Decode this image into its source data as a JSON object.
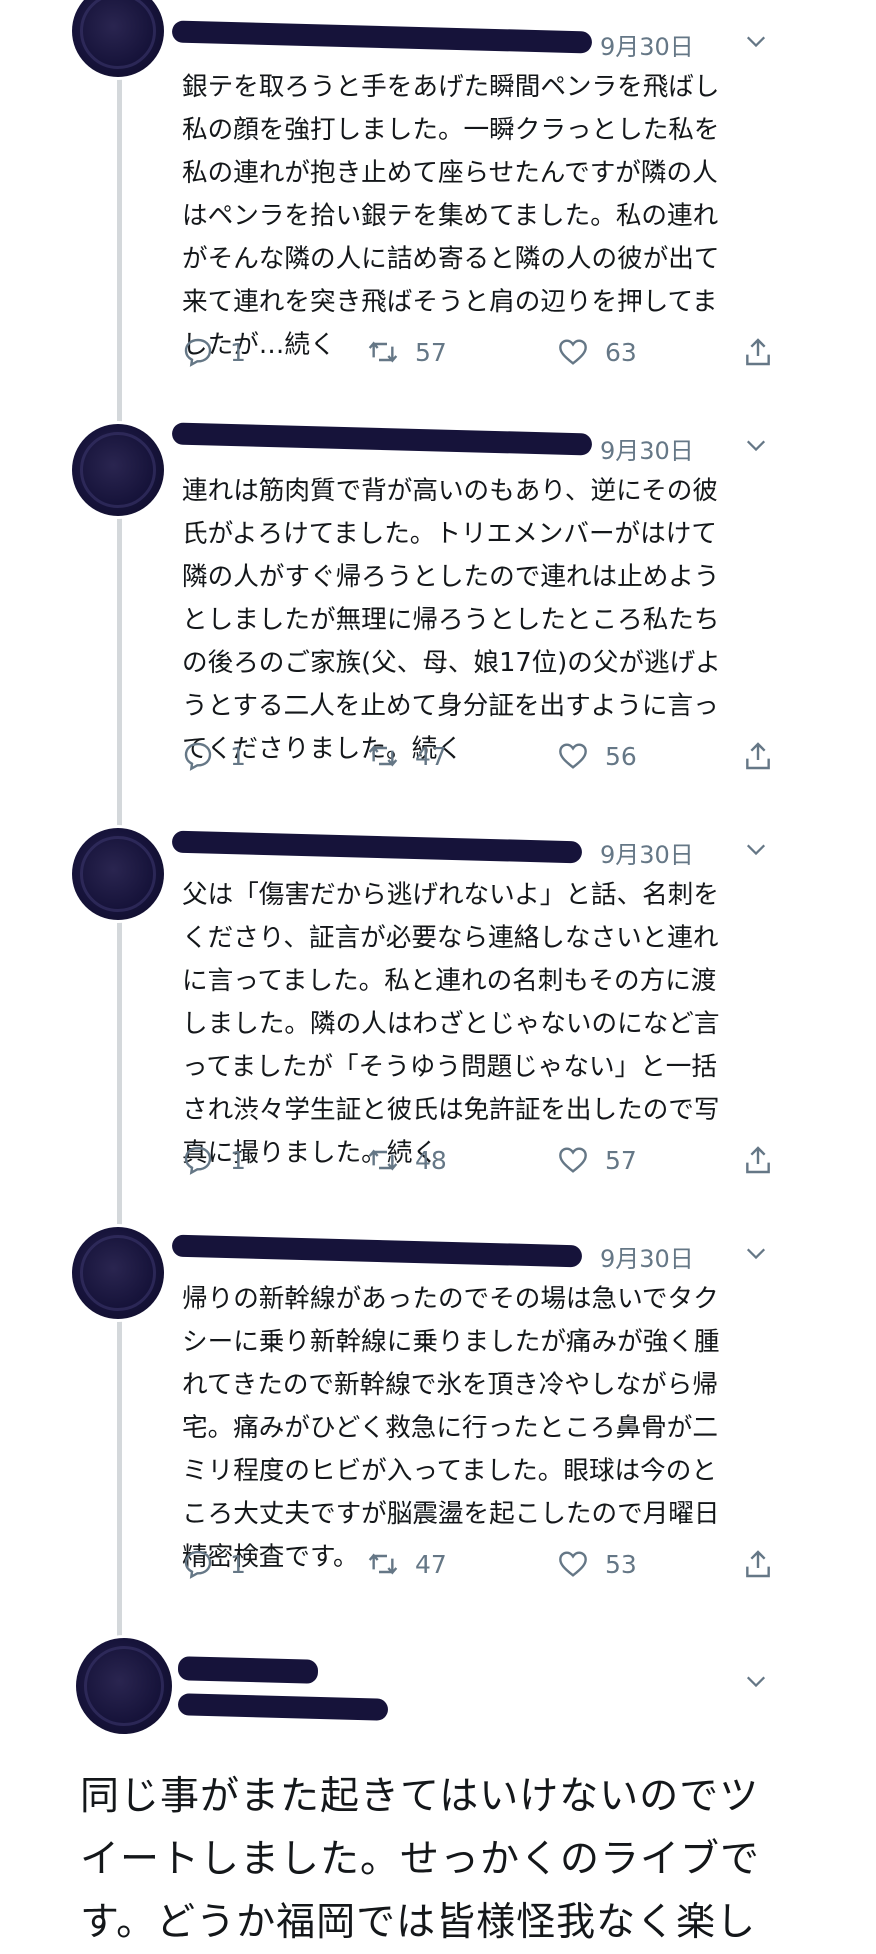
{
  "tweets": [
    {
      "date": "9月30日",
      "text": "銀テを取ろうと手をあげた瞬間ペンラを飛ばし\n私の顔を強打しました。一瞬クラっとした私を\n私の連れが抱き止めて座らせたんですが隣の人\nはペンラを拾い銀テを集めてました。私の連れ\nがそんな隣の人に詰め寄ると隣の人の彼が出て\n来て連れを突き飛ばそうと肩の辺りを押してま\nしたが…続く",
      "replies": "1",
      "retweets": "57",
      "likes": "63"
    },
    {
      "date": "9月30日",
      "text": "連れは筋肉質で背が高いのもあり、逆にその彼\n氏がよろけてました。トリエメンバーがはけて\n隣の人がすぐ帰ろうとしたので連れは止めよう\nとしましたが無理に帰ろうとしたところ私たち\nの後ろのご家族(父、母、娘17位)の父が逃げよ\nうとする二人を止めて身分証を出すように言っ\nてくださりました。続く",
      "replies": "1",
      "retweets": "47",
      "likes": "56"
    },
    {
      "date": "9月30日",
      "text": "父は「傷害だから逃げれないよ」と話、名刺を\nくださり、証言が必要なら連絡しなさいと連れ\nに言ってました。私と連れの名刺もその方に渡\nしました。隣の人はわざとじゃないのになど言\nってましたが「そうゆう問題じゃない」と一括\nされ渋々学生証と彼氏は免許証を出したので写\n真に撮りました。続く",
      "replies": "1",
      "retweets": "48",
      "likes": "57"
    },
    {
      "date": "9月30日",
      "text": "帰りの新幹線があったのでその場は急いでタク\nシーに乗り新幹線に乗りましたが痛みが強く腫\nれてきたので新幹線で氷を頂き冷やしながら帰\n宅。痛みがひどく救急に行ったところ鼻骨が二\nミリ程度のヒビが入ってました。眼球は今のと\nころ大丈夫ですが脳震盪を起こしたので月曜日\n精密検査です。",
      "replies": "1",
      "retweets": "47",
      "likes": "53"
    }
  ],
  "main_tweet": {
    "text": "同じ事がまた起きてはいけないのでツ\nイートしました。せっかくのライブで\nす。どうか福岡では皆様怪我なく楽し"
  },
  "icons": {
    "reply": "reply-icon",
    "retweet": "retweet-icon",
    "like": "heart-icon",
    "share": "share-icon",
    "more": "chevron-down-icon"
  },
  "colors": {
    "text": "#14171a",
    "secondary": "#657786",
    "thread_line": "#d4d8db",
    "redaction": "#16133a"
  }
}
